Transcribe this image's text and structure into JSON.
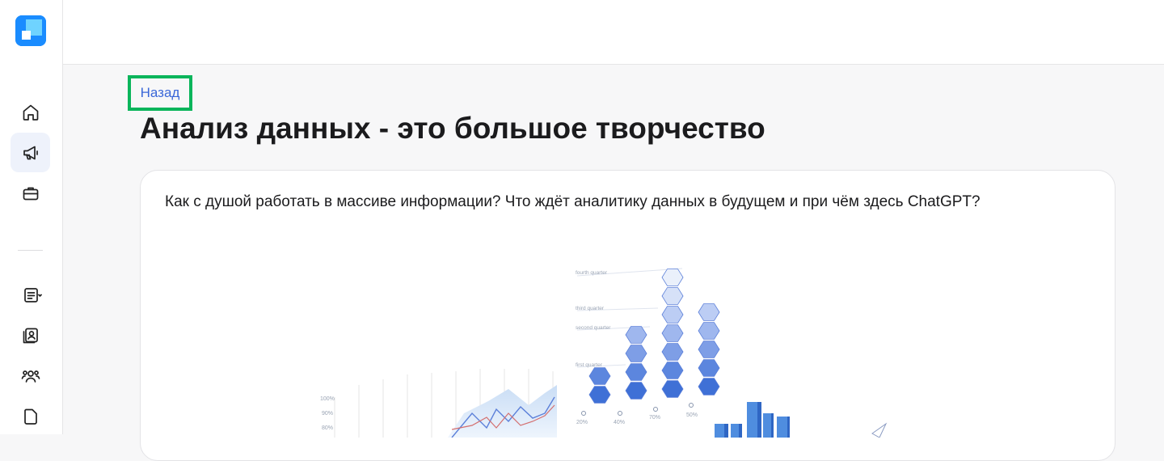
{
  "sidebar": {
    "items": [
      {
        "icon": "home-icon"
      },
      {
        "icon": "megaphone-icon",
        "active": true
      },
      {
        "icon": "briefcase-icon"
      },
      {
        "icon": "document-list-icon"
      },
      {
        "icon": "contacts-icon"
      },
      {
        "icon": "users-icon"
      },
      {
        "icon": "file-icon"
      }
    ]
  },
  "page": {
    "back_label": "Назад",
    "title": "Анализ данных - это большое творчество",
    "lead": "Как с душой работать в массиве информации? Что ждёт аналитику данных в будущем и при чём здесь ChatGPT?"
  },
  "illustration": {
    "quarters": [
      "fourth quarter",
      "third quarter",
      "second quarter",
      "first quarter"
    ],
    "percent_labels": [
      "20%",
      "40%",
      "70%",
      "50%"
    ],
    "axis_labels": [
      "100%",
      "90%",
      "80%"
    ],
    "colors": {
      "highlight": "#0ab55b",
      "link": "#3a67d8",
      "accent": "#1a8cff"
    }
  }
}
